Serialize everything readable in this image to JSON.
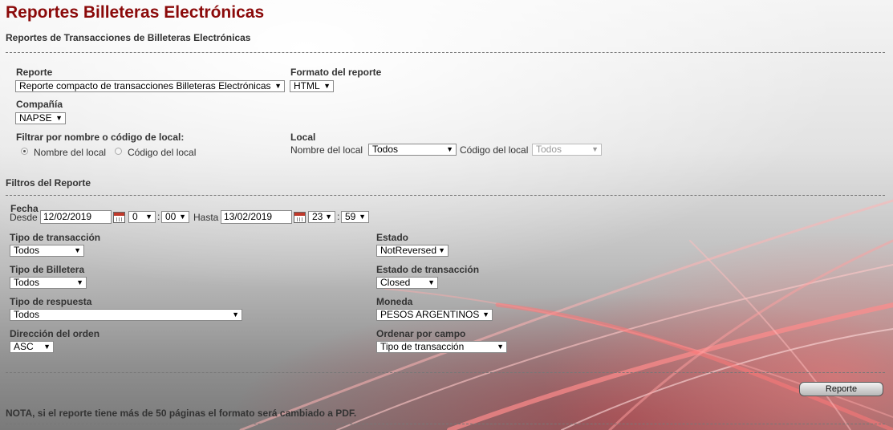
{
  "page": {
    "title": "Reportes Billeteras Electrónicas",
    "subtitle": "Reportes de Transacciones de Billeteras Electrónicas"
  },
  "report": {
    "label": "Reporte",
    "value": "Reporte compacto de transacciones Billeteras Electrónicas"
  },
  "format": {
    "label": "Formato del reporte",
    "value": "HTML"
  },
  "company": {
    "label": "Compañía",
    "value": "NAPSE"
  },
  "filter_by": {
    "label": "Filtrar por nombre o código de local:",
    "option_name": "Nombre del local",
    "option_code": "Código del local",
    "selected": "Nombre del local"
  },
  "store": {
    "label": "Local",
    "name_label": "Nombre del local",
    "name_value": "Todos",
    "code_label": "Código del local",
    "code_value": "Todos"
  },
  "filters": {
    "section_title": "Filtros del Reporte",
    "date": {
      "label": "Fecha",
      "from_label": "Desde",
      "from_value": "12/02/2019",
      "from_hour": "0",
      "from_minute": "00",
      "to_label": "Hasta",
      "to_value": "13/02/2019",
      "to_hour": "23",
      "to_minute": "59",
      "separator": ":"
    },
    "transaction_type": {
      "label": "Tipo de transacción",
      "value": "Todos"
    },
    "wallet_type": {
      "label": "Tipo de Billetera",
      "value": "Todos"
    },
    "response_type": {
      "label": "Tipo de respuesta",
      "value": "Todos"
    },
    "order_direction": {
      "label": "Dirección del orden",
      "value": "ASC"
    },
    "status": {
      "label": "Estado",
      "value": "NotReversed"
    },
    "transaction_status": {
      "label": "Estado de transacción",
      "value": "Closed"
    },
    "currency": {
      "label": "Moneda",
      "value": "PESOS ARGENTINOS"
    },
    "sort_field": {
      "label": "Ordenar por campo",
      "value": "Tipo de transacción"
    }
  },
  "actions": {
    "report_button": "Reporte"
  },
  "note": "NOTA, si el reporte tiene más de 50 páginas el formato será cambiado a PDF.",
  "icons": {
    "dropdown": "chevron-down-icon",
    "calendar": "calendar-icon"
  },
  "colors": {
    "title": "#8b0a0a",
    "accent": "#c0392b"
  }
}
